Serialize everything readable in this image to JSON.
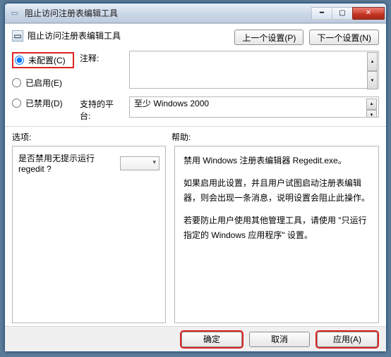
{
  "window": {
    "title": "阻止访问注册表编辑工具"
  },
  "policy": {
    "name": "阻止访问注册表编辑工具"
  },
  "nav": {
    "prev": "上一个设置(P)",
    "next": "下一个设置(N)"
  },
  "radios": {
    "not_configured": "未配置(C)",
    "enabled": "已启用(E)",
    "disabled": "已禁用(D)",
    "selected": "not_configured"
  },
  "labels": {
    "comment": "注释:",
    "platform": "支持的平台:",
    "options": "选项:",
    "help": "帮助:"
  },
  "comment": "",
  "platform": "至少 Windows 2000",
  "options": {
    "question": "是否禁用无提示运行 regedit ?",
    "value": ""
  },
  "help": {
    "p1": "禁用 Windows 注册表编辑器 Regedit.exe。",
    "p2": "如果启用此设置，并且用户试图启动注册表编辑器，则会出现一条消息，说明设置会阻止此操作。",
    "p3": "若要防止用户使用其他管理工具，请使用 \"只运行指定的 Windows 应用程序\" 设置。"
  },
  "footer": {
    "ok": "确定",
    "cancel": "取消",
    "apply": "应用(A)"
  }
}
